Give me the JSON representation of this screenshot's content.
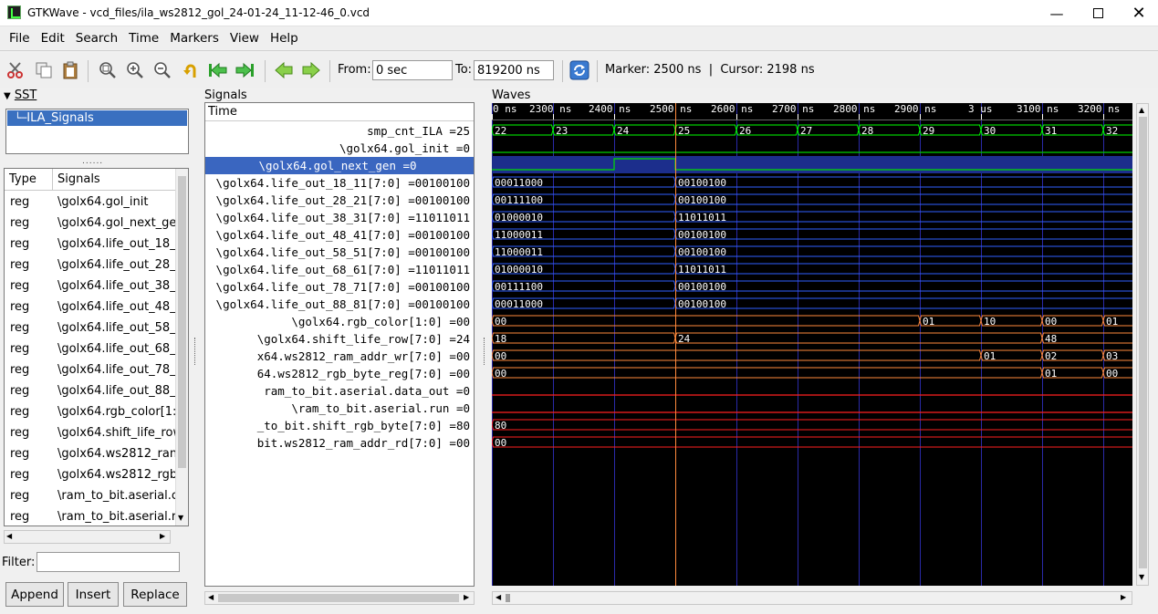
{
  "window": {
    "title": "GTKWave - vcd_files/ila_ws2812_gol_24-01-24_11-12-46_0.vcd"
  },
  "menu": [
    "File",
    "Edit",
    "Search",
    "Time",
    "Markers",
    "View",
    "Help"
  ],
  "toolbar": {
    "from_label": "From:",
    "from_value": "0 sec",
    "to_label": "To:",
    "to_value": "819200 ns",
    "marker_text": "Marker: 2500 ns  |  Cursor: 2198 ns"
  },
  "sst": {
    "header": "SST",
    "tree_item": "ILA_Signals",
    "columns": {
      "type": "Type",
      "signals": "Signals"
    },
    "rows": [
      {
        "type": "reg",
        "name": "\\golx64.gol_init"
      },
      {
        "type": "reg",
        "name": "\\golx64.gol_next_ge"
      },
      {
        "type": "reg",
        "name": "\\golx64.life_out_18_"
      },
      {
        "type": "reg",
        "name": "\\golx64.life_out_28_"
      },
      {
        "type": "reg",
        "name": "\\golx64.life_out_38_"
      },
      {
        "type": "reg",
        "name": "\\golx64.life_out_48_"
      },
      {
        "type": "reg",
        "name": "\\golx64.life_out_58_"
      },
      {
        "type": "reg",
        "name": "\\golx64.life_out_68_"
      },
      {
        "type": "reg",
        "name": "\\golx64.life_out_78_"
      },
      {
        "type": "reg",
        "name": "\\golx64.life_out_88_"
      },
      {
        "type": "reg",
        "name": "\\golx64.rgb_color[1:"
      },
      {
        "type": "reg",
        "name": "\\golx64.shift_life_row"
      },
      {
        "type": "reg",
        "name": "\\golx64.ws2812_ran"
      },
      {
        "type": "reg",
        "name": "\\golx64.ws2812_rgb"
      },
      {
        "type": "reg",
        "name": "\\ram_to_bit.aserial.c"
      },
      {
        "type": "reg",
        "name": "\\ram_to_bit.aserial.r"
      }
    ],
    "filter_label": "Filter:",
    "filter_value": "",
    "buttons": {
      "append": "Append",
      "insert": "Insert",
      "replace": "Replace"
    }
  },
  "signals": {
    "header": "Signals",
    "time_header": "Time",
    "rows": [
      "smp_cnt_ILA =25",
      "\\golx64.gol_init =0",
      "\\golx64.gol_next_gen =0",
      "\\golx64.life_out_18_11[7:0] =00100100",
      "\\golx64.life_out_28_21[7:0] =00100100",
      "\\golx64.life_out_38_31[7:0] =11011011",
      "\\golx64.life_out_48_41[7:0] =00100100",
      "\\golx64.life_out_58_51[7:0] =00100100",
      "\\golx64.life_out_68_61[7:0] =11011011",
      "\\golx64.life_out_78_71[7:0] =00100100",
      "\\golx64.life_out_88_81[7:0] =00100100",
      "\\golx64.rgb_color[1:0] =00",
      "\\golx64.shift_life_row[7:0] =24",
      "x64.ws2812_ram_addr_wr[7:0] =00",
      "64.ws2812_rgb_byte_reg[7:0] =00",
      "ram_to_bit.aserial.data_out =0",
      "\\ram_to_bit.aserial.run =0",
      "_to_bit.shift_rgb_byte[7:0] =80",
      "bit.ws2812_ram_addr_rd[7:0] =00"
    ]
  },
  "waves": {
    "header": "Waves",
    "time_ticks": [
      {
        "t": "0 ns"
      },
      {
        "t": "2300 ns"
      },
      {
        "t": "2400 ns"
      },
      {
        "t": "2500 ns"
      },
      {
        "t": "2600 ns"
      },
      {
        "t": "2700 ns"
      },
      {
        "t": "2800 ns"
      },
      {
        "t": "2900 ns"
      },
      {
        "t": "3 us"
      },
      {
        "t": "3100 ns"
      },
      {
        "t": "3200 ns"
      }
    ],
    "bus_labels": {
      "smp_cnt": [
        "22",
        "23",
        "24",
        "25",
        "26",
        "27",
        "28",
        "29",
        "30",
        "31",
        "32"
      ],
      "life_18": [
        "00011000",
        "00100100"
      ],
      "life_28": [
        "00111100",
        "00100100"
      ],
      "life_38": [
        "01000010",
        "11011011"
      ],
      "life_48": [
        "11000011",
        "00100100"
      ],
      "life_58": [
        "11000011",
        "00100100"
      ],
      "life_68": [
        "01000010",
        "11011011"
      ],
      "life_78": [
        "00111100",
        "00100100"
      ],
      "life_88": [
        "00011000",
        "00100100"
      ],
      "rgb_color": [
        "00",
        "01",
        "10",
        "00",
        "01"
      ],
      "shift_life_row": [
        "18",
        "24",
        "48"
      ],
      "ram_addr_wr": [
        "00",
        "01",
        "02",
        "03"
      ],
      "rgb_byte_reg": [
        "00",
        "01",
        "00"
      ],
      "shift_rgb_byte": [
        "80"
      ],
      "ram_addr_rd": [
        "00"
      ]
    },
    "colors": {
      "bus": "#00ff00",
      "value_bus": "#ff8a3c",
      "binary": "#3060ff",
      "zero": "#ff2020",
      "marker": "#ff8a3c",
      "grid": "#2a2aa8"
    }
  }
}
